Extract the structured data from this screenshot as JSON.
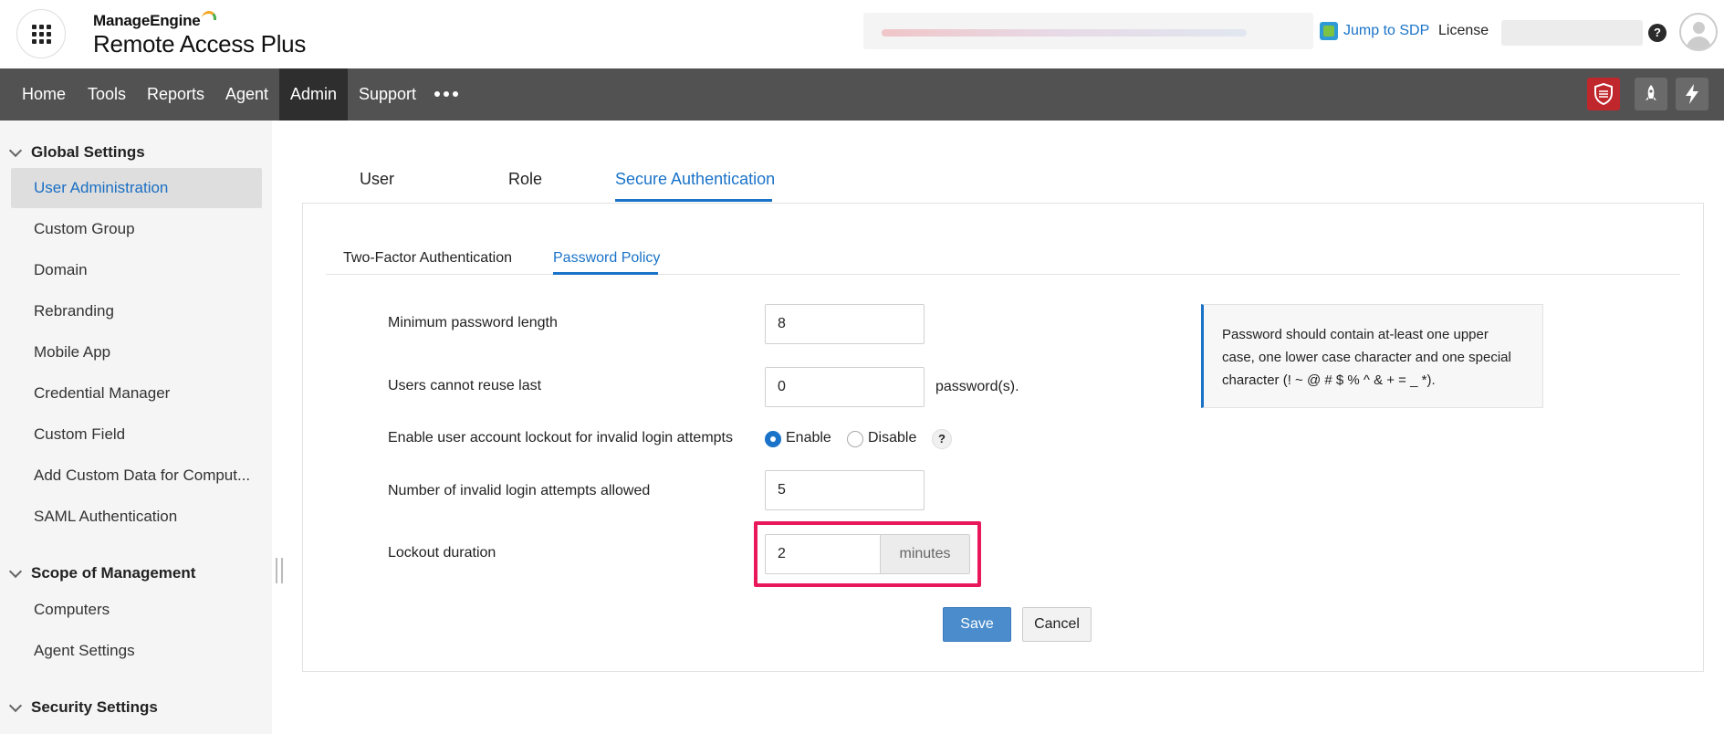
{
  "header": {
    "brand_top": "ManageEngine",
    "brand_name": "Remote Access Plus",
    "jump_link": "Jump to SDP",
    "license_label": "License",
    "help_glyph": "?"
  },
  "nav": {
    "items": [
      {
        "label": "Home"
      },
      {
        "label": "Tools"
      },
      {
        "label": "Reports"
      },
      {
        "label": "Agent"
      },
      {
        "label": "Admin"
      },
      {
        "label": "Support"
      }
    ],
    "active": "Admin",
    "icons": [
      "shield-icon",
      "rocket-icon",
      "lightning-icon"
    ],
    "shield_color": "#c0272d"
  },
  "sidebar": {
    "global_settings": {
      "title": "Global Settings",
      "items": [
        {
          "label": "User Administration"
        },
        {
          "label": "Custom Group"
        },
        {
          "label": "Domain"
        },
        {
          "label": "Rebranding"
        },
        {
          "label": "Mobile App"
        },
        {
          "label": "Credential Manager"
        },
        {
          "label": "Custom Field"
        },
        {
          "label": "Add Custom Data for Comput..."
        },
        {
          "label": "SAML Authentication"
        }
      ]
    },
    "scope": {
      "title": "Scope of Management",
      "items": [
        {
          "label": "Computers"
        },
        {
          "label": "Agent Settings"
        }
      ]
    },
    "security": {
      "title": "Security Settings"
    },
    "active_item": "User Administration"
  },
  "main_tabs": {
    "items": [
      {
        "label": "User"
      },
      {
        "label": "Role"
      },
      {
        "label": "Secure Authentication"
      }
    ],
    "active": "Secure Authentication"
  },
  "sub_tabs": {
    "items": [
      {
        "label": "Two-Factor Authentication"
      },
      {
        "label": "Password Policy"
      }
    ],
    "active": "Password Policy"
  },
  "form": {
    "min_length": {
      "label": "Minimum password length",
      "value": "8"
    },
    "reuse": {
      "label": "Users cannot reuse last",
      "value": "0",
      "suffix": "password(s)."
    },
    "lockout_enable": {
      "label": "Enable user account lockout for invalid login attempts",
      "options": [
        "Enable",
        "Disable"
      ],
      "selected": "Enable",
      "help": "?"
    },
    "invalid_attempts": {
      "label": "Number of invalid login attempts allowed",
      "value": "5"
    },
    "lockout_duration": {
      "label": "Lockout duration",
      "value": "2",
      "unit": "minutes"
    }
  },
  "info": {
    "text": "Password should contain at-least one upper case, one lower case character and one special character (! ~ @ # $ % ^ & + = _ *)."
  },
  "buttons": {
    "save": "Save",
    "cancel": "Cancel"
  },
  "colors": {
    "accent": "#1a73c8",
    "nav_bg": "#525252",
    "highlight": "#e8185a",
    "save_bg": "#4a8ccc"
  }
}
